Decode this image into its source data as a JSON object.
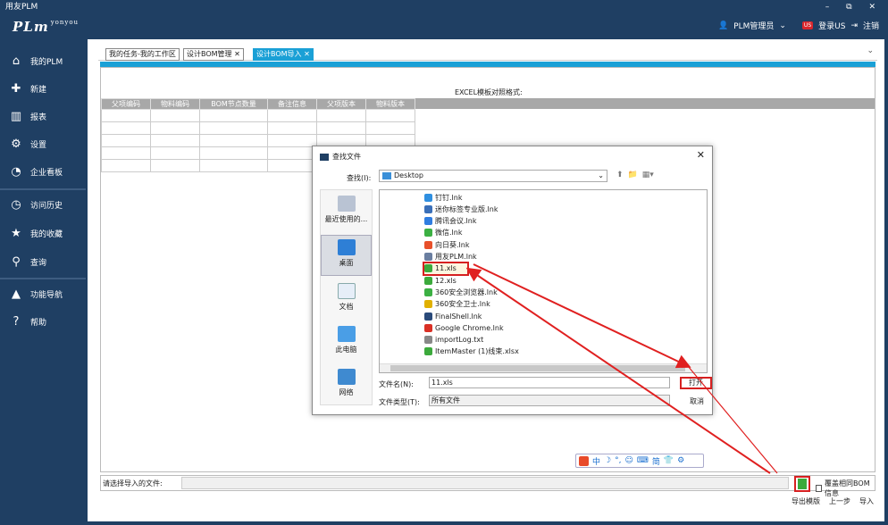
{
  "window": {
    "title": "用友PLM",
    "controls": "– ⧉ ✕"
  },
  "header": {
    "logo_text": "PLm",
    "logo_sub": "yonyou",
    "user_label": "PLM管理员",
    "us_badge": "US",
    "login_us": "登录US",
    "logout": "注销"
  },
  "sidebar": {
    "items": [
      {
        "label": "我的PLM",
        "icon": "home-icon"
      },
      {
        "label": "新建",
        "icon": "new-icon"
      },
      {
        "label": "报表",
        "icon": "report-icon"
      },
      {
        "label": "设置",
        "icon": "gear-icon"
      },
      {
        "label": "企业看板",
        "icon": "dashboard-icon"
      },
      {
        "label": "访问历史",
        "icon": "history-icon"
      },
      {
        "label": "我的收藏",
        "icon": "star-icon"
      },
      {
        "label": "查询",
        "icon": "search-icon"
      },
      {
        "label": "功能导航",
        "icon": "nav-icon"
      },
      {
        "label": "帮助",
        "icon": "help-icon"
      }
    ]
  },
  "tabs": [
    {
      "label": "我的任务-我的工作区"
    },
    {
      "label": "设计BOM管理 ✕"
    },
    {
      "label": "设计BOM导入 ✕"
    }
  ],
  "main": {
    "excel_title": "EXCEL模板对照格式:",
    "columns": [
      "父项编码",
      "物料编码",
      "BOM节点数量",
      "备注信息",
      "父项版本",
      "物料版本"
    ],
    "file_label": "请选择导入的文件:",
    "overwrite_label": "覆盖相同BOM信息",
    "actions": [
      "导出模版",
      "上一步",
      "导入"
    ]
  },
  "ime_bar": {
    "items": [
      "中",
      "☽",
      "°,",
      "☺",
      "⌨",
      "简",
      "👕",
      "⚙"
    ]
  },
  "dialog": {
    "title": "查找文件",
    "close": "✕",
    "look_in_label": "查找(I):",
    "look_in_value": "Desktop",
    "places": [
      "最近使用的...",
      "桌面",
      "文档",
      "此电脑",
      "网络"
    ],
    "files": [
      {
        "name": "钉钉.lnk",
        "color": "#2f8fe0"
      },
      {
        "name": "迷你标签专业版.lnk",
        "color": "#3a6fb8"
      },
      {
        "name": "腾讯会议.lnk",
        "color": "#2f7de0"
      },
      {
        "name": "微信.lnk",
        "color": "#3cb043"
      },
      {
        "name": "向日葵.lnk",
        "color": "#e8502a"
      },
      {
        "name": "用友PLM.lnk",
        "color": "#6a7ea0"
      },
      {
        "name": "11.xls",
        "color": "#3caa3c"
      },
      {
        "name": "12.xls",
        "color": "#3caa3c"
      },
      {
        "name": "360安全浏览器.lnk",
        "color": "#3cb043"
      },
      {
        "name": "360安全卫士.lnk",
        "color": "#e0b000"
      },
      {
        "name": "FinalShell.lnk",
        "color": "#2a4a7a"
      },
      {
        "name": "Google Chrome.lnk",
        "color": "#d93025"
      },
      {
        "name": "importLog.txt",
        "color": "#888888"
      },
      {
        "name": "ItemMaster (1)线束.xlsx",
        "color": "#3caa3c"
      }
    ],
    "selected_file": "11.xls",
    "filename_label": "文件名(N):",
    "filename_value": "11.xls",
    "filetype_label": "文件类型(T):",
    "filetype_value": "所有文件",
    "open_label": "打开",
    "cancel_label": "取消"
  }
}
